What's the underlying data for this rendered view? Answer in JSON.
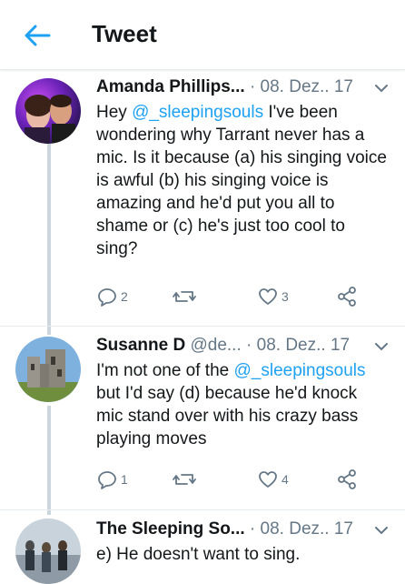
{
  "header": {
    "title": "Tweet"
  },
  "tweets": [
    {
      "name": "Amanda Phillips...",
      "handle": "",
      "date": "08. Dez.. 17",
      "text_pre": "Hey ",
      "mention": "@_sleepingsouls",
      "text_post": " I've been wondering why Tarrant never has a mic. Is it because (a) his singing voice is awful (b) his singing voice is amazing and he'd put you all to shame or (c) he's just too cool to sing?",
      "replies": "2",
      "retweets": "",
      "likes": "3"
    },
    {
      "name": "Susanne D",
      "handle": "@de...",
      "date": "08. Dez.. 17",
      "text_pre": "I'm not one of the ",
      "mention": "@_sleepingsouls",
      "text_post": " but I'd say (d) because he'd knock mic stand over with his crazy bass playing moves",
      "replies": "1",
      "retweets": "",
      "likes": "4"
    },
    {
      "name": "The Sleeping So...",
      "handle": "",
      "date": "08. Dez.. 17",
      "text_pre": "e) He doesn't want to sing.",
      "mention": "",
      "text_post": "",
      "replies": "",
      "retweets": "",
      "likes": ""
    }
  ],
  "colors": {
    "accent": "#1da1f2",
    "secondary_text": "#657786",
    "line": "#ccd6dd"
  }
}
